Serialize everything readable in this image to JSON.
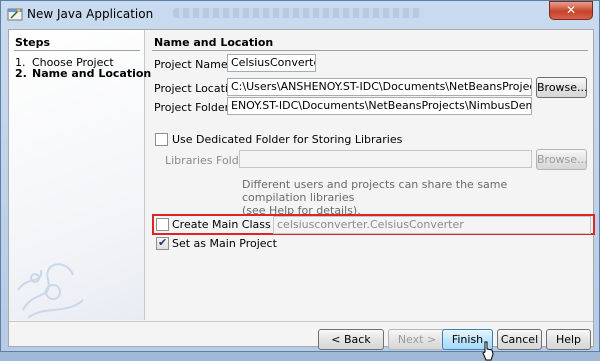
{
  "window": {
    "title": "New Java Application",
    "close_label": "✕"
  },
  "steps": {
    "title": "Steps",
    "items": [
      {
        "num": "1.",
        "label": "Choose Project"
      },
      {
        "num": "2.",
        "label": "Name and Location"
      }
    ]
  },
  "section": {
    "title": "Name and Location"
  },
  "form": {
    "project_name_label": "Project Name:",
    "project_name_value": "CelsiusConverter",
    "project_location_label": "Project Location:",
    "project_location_value": "C:\\Users\\ANSHENOY.ST-IDC\\Documents\\NetBeansProjects\\NimbusDemo",
    "browse_label": "Browse...",
    "project_folder_label": "Project Folder:",
    "project_folder_value": "ENOY.ST-IDC\\Documents\\NetBeansProjects\\NimbusDemo\\CelsiusConverter",
    "dedicated_folder_label": "Use Dedicated Folder for Storing Libraries",
    "libraries_folder_label": "Libraries Folder:",
    "libraries_folder_value": "",
    "libraries_browse_label": "Browse...",
    "hint_line1": "Different users and projects can share the same compilation libraries",
    "hint_line2": "(see Help for details).",
    "create_main_class_label": "Create Main Class",
    "create_main_class_value": "celsiusconverter.CelsiusConverter",
    "set_main_project_label": "Set as Main Project"
  },
  "buttons": {
    "back": "< Back",
    "next": "Next >",
    "finish": "Finish",
    "cancel": "Cancel",
    "help": "Help"
  },
  "colors": {
    "highlight": "#e02424",
    "title_bar": "#c9dbef"
  }
}
